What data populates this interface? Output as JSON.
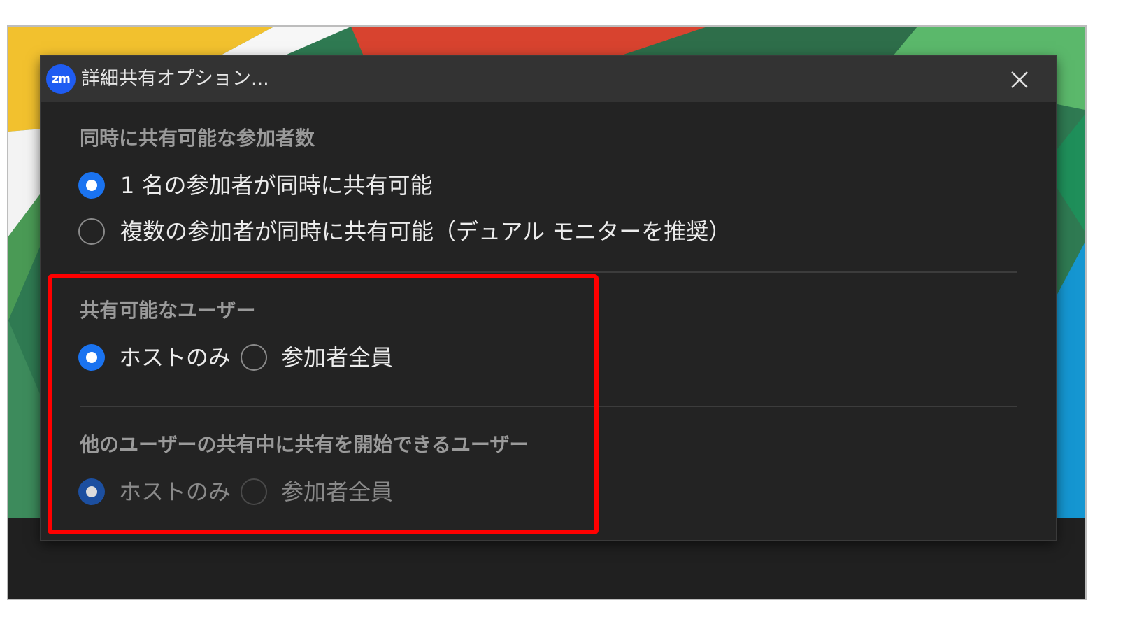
{
  "window": {
    "app_logo_text": "zm",
    "title": "詳細共有オプション..."
  },
  "sections": [
    {
      "label": "同時に共有可能な参加者数",
      "options": [
        {
          "label": "1 名の参加者が同時に共有可能",
          "selected": true
        },
        {
          "label": "複数の参加者が同時に共有可能（デュアル モニターを推奨）",
          "selected": false
        }
      ]
    },
    {
      "label": "共有可能なユーザー",
      "options": [
        {
          "label": "ホストのみ",
          "selected": true
        },
        {
          "label": "参加者全員",
          "selected": false
        }
      ]
    },
    {
      "label": "他のユーザーの共有中に共有を開始できるユーザー",
      "disabled": true,
      "options": [
        {
          "label": "ホストのみ",
          "selected": true
        },
        {
          "label": "参加者全員",
          "selected": false
        }
      ]
    }
  ],
  "colors": {
    "accent": "#1a73f0",
    "dialog_bg": "#232323",
    "titlebar_bg": "#333333",
    "highlight": "#ff0000"
  },
  "icons": {
    "close": "close-icon",
    "logo": "zoom-logo-icon"
  }
}
